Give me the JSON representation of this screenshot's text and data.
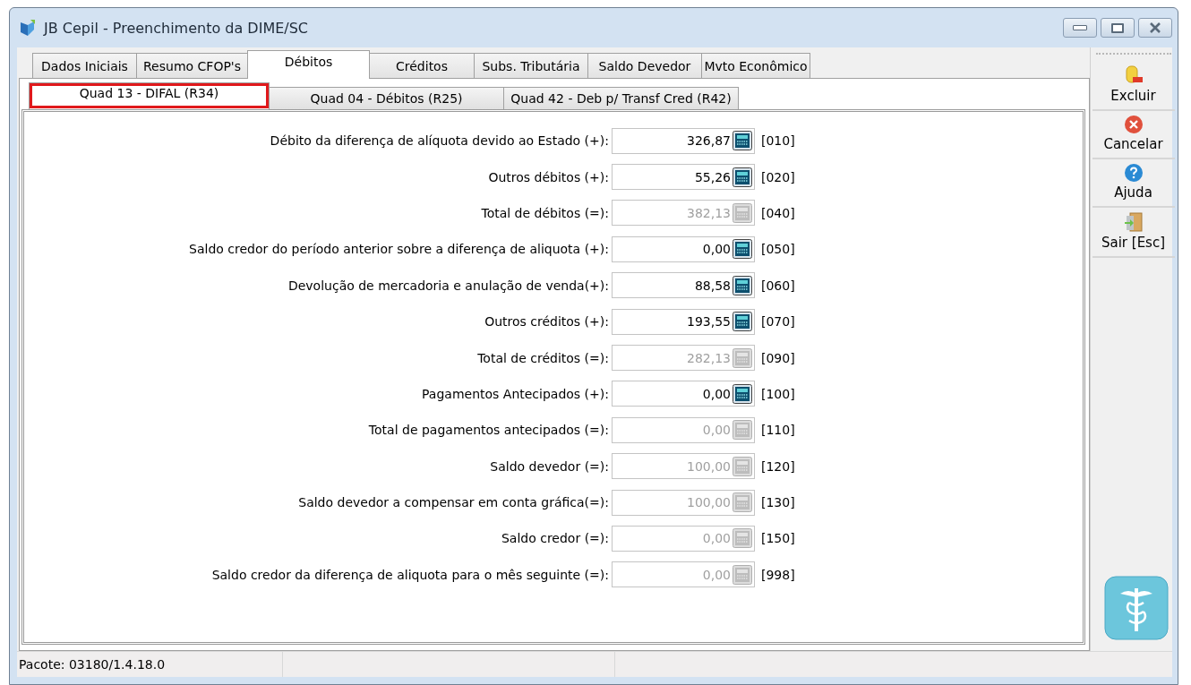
{
  "window": {
    "title": "JB Cepil - Preenchimento da DIME/SC"
  },
  "tabs": [
    {
      "label": "Dados Iniciais",
      "selected": false
    },
    {
      "label": "Resumo CFOP's",
      "selected": false
    },
    {
      "label": "Débitos",
      "selected": true
    },
    {
      "label": "Créditos",
      "selected": false
    },
    {
      "label": "Subs. Tributária",
      "selected": false
    },
    {
      "label": "Saldo Devedor",
      "selected": false
    },
    {
      "label": "Mvto Econômico",
      "selected": false
    }
  ],
  "subtabs": [
    {
      "label": "Quad 13 - DIFAL (R34)",
      "selected": true,
      "highlighted": true
    },
    {
      "label": "Quad 04 - Débitos (R25)",
      "selected": false,
      "highlighted": false
    },
    {
      "label": "Quad 42 - Deb p/ Transf Cred (R42)",
      "selected": false,
      "highlighted": false
    }
  ],
  "fields": [
    {
      "label": "Débito da diferença de alíquota devido ao Estado (+):",
      "value": "326,87",
      "code": "[010]",
      "disabled": false
    },
    {
      "label": "Outros débitos (+):",
      "value": "55,26",
      "code": "[020]",
      "disabled": false
    },
    {
      "label": "Total de débitos (=):",
      "value": "382,13",
      "code": "[040]",
      "disabled": true
    },
    {
      "label": "Saldo credor do período anterior sobre a diferença de aliquota (+):",
      "value": "0,00",
      "code": "[050]",
      "disabled": false
    },
    {
      "label": "Devolução de mercadoria e anulação de venda(+):",
      "value": "88,58",
      "code": "[060]",
      "disabled": false
    },
    {
      "label": "Outros créditos (+):",
      "value": "193,55",
      "code": "[070]",
      "disabled": false
    },
    {
      "label": "Total de créditos (=):",
      "value": "282,13",
      "code": "[090]",
      "disabled": true
    },
    {
      "label": "Pagamentos Antecipados (+):",
      "value": "0,00",
      "code": "[100]",
      "disabled": false
    },
    {
      "label": "Total de pagamentos antecipados (=):",
      "value": "0,00",
      "code": "[110]",
      "disabled": true
    },
    {
      "label": "Saldo devedor (=):",
      "value": "100,00",
      "code": "[120]",
      "disabled": true
    },
    {
      "label": "Saldo devedor a compensar em conta gráfica(=):",
      "value": "100,00",
      "code": "[130]",
      "disabled": true
    },
    {
      "label": "Saldo credor (=):",
      "value": "0,00",
      "code": "[150]",
      "disabled": true
    },
    {
      "label": "Saldo credor da diferença de aliquota para o mês seguinte (=):",
      "value": "0,00",
      "code": "[998]",
      "disabled": true
    }
  ],
  "toolbar": [
    {
      "label": "Excluir",
      "kind": "delete"
    },
    {
      "label": "Cancelar",
      "kind": "cancel"
    },
    {
      "label": "Ajuda",
      "kind": "help"
    },
    {
      "label": "Sair [Esc]",
      "kind": "exit"
    }
  ],
  "status_bar": {
    "text": "Pacote: 03180/1.4.18.0"
  }
}
